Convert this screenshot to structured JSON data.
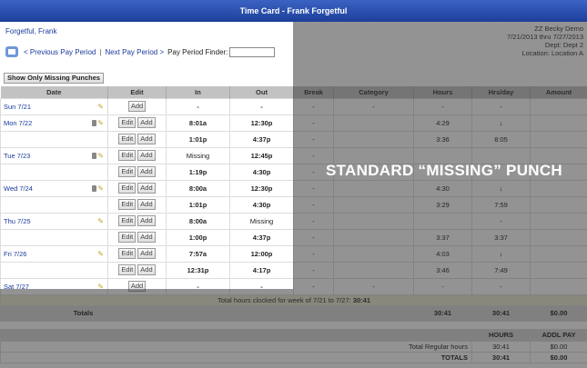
{
  "window_title": "Time Card - Frank Forgetful",
  "employee_name": "Forgetful, Frank",
  "nav": {
    "prev": "< Previous Pay Period",
    "sep": "|",
    "next": "Next Pay Period >",
    "finder_label": "Pay Period Finder:"
  },
  "company": {
    "name": "ZZ Becky Demo",
    "period": "7/21/2013 thru 7/27/2013",
    "dept": "Dept: Dept 2",
    "location": "Location: Location A"
  },
  "missing_button": "Show Only Missing Punches",
  "columns": [
    "Date",
    "Edit",
    "In",
    "Out",
    "Break",
    "Category",
    "Hours",
    "Hrs/day",
    "Amount"
  ],
  "edit_labels": {
    "edit": "Edit",
    "add": "Add"
  },
  "rows": [
    {
      "date": "Sun 7/21",
      "icons": "pencil",
      "edit": [
        "Add"
      ],
      "in": "-",
      "out": "-",
      "break": "-",
      "category": "-",
      "hours": "-",
      "hrsday": "-",
      "amount": ""
    },
    {
      "date": "Mon 7/22",
      "icons": "trash-pencil",
      "edit": [
        "Edit",
        "Add"
      ],
      "in": "8:01a",
      "out": "12:30p",
      "break": "-",
      "category": "",
      "hours": "4:29",
      "hrsday": "↓",
      "amount": ""
    },
    {
      "date": "",
      "icons": "",
      "edit": [
        "Edit",
        "Add"
      ],
      "in": "1:01p",
      "out": "4:37p",
      "break": "-",
      "category": "",
      "hours": "3:36",
      "hrsday": "8:05",
      "amount": ""
    },
    {
      "date": "Tue 7/23",
      "icons": "trash-pencil",
      "edit": [
        "Edit",
        "Add"
      ],
      "in": "Missing",
      "out": "12:45p",
      "break": "-",
      "category": "",
      "hours": "",
      "hrsday": "",
      "amount": ""
    },
    {
      "date": "",
      "icons": "",
      "edit": [
        "Edit",
        "Add"
      ],
      "in": "1:19p",
      "out": "4:30p",
      "break": "-",
      "category": "",
      "hours": "",
      "hrsday": "",
      "amount": ""
    },
    {
      "date": "Wed 7/24",
      "icons": "trash-pencil",
      "edit": [
        "Edit",
        "Add"
      ],
      "in": "8:00a",
      "out": "12:30p",
      "break": "-",
      "category": "",
      "hours": "4:30",
      "hrsday": "↓",
      "amount": ""
    },
    {
      "date": "",
      "icons": "",
      "edit": [
        "Edit",
        "Add"
      ],
      "in": "1:01p",
      "out": "4:30p",
      "break": "-",
      "category": "",
      "hours": "3:29",
      "hrsday": "7:59",
      "amount": ""
    },
    {
      "date": "Thu 7/25",
      "icons": "pencil",
      "edit": [
        "Edit",
        "Add"
      ],
      "in": "8:00a",
      "out": "Missing",
      "break": "-",
      "category": "",
      "hours": "",
      "hrsday": "-",
      "amount": ""
    },
    {
      "date": "",
      "icons": "",
      "edit": [
        "Edit",
        "Add"
      ],
      "in": "1:00p",
      "out": "4:37p",
      "break": "-",
      "category": "",
      "hours": "3:37",
      "hrsday": "3:37",
      "amount": ""
    },
    {
      "date": "Fri 7/26",
      "icons": "pencil",
      "edit": [
        "Edit",
        "Add"
      ],
      "in": "7:57a",
      "out": "12:00p",
      "break": "-",
      "category": "",
      "hours": "4:03",
      "hrsday": "↓",
      "amount": ""
    },
    {
      "date": "",
      "icons": "",
      "edit": [
        "Edit",
        "Add"
      ],
      "in": "12:31p",
      "out": "4:17p",
      "break": "-",
      "category": "",
      "hours": "3:46",
      "hrsday": "7:49",
      "amount": ""
    },
    {
      "date": "Sat 7/27",
      "icons": "pencil",
      "edit": [
        "Add"
      ],
      "in": "-",
      "out": "-",
      "break": "-",
      "category": "-",
      "hours": "-",
      "hrsday": "-",
      "amount": ""
    }
  ],
  "week_total": {
    "label": "Total hours clocked for week of 7/21 to 7/27:",
    "value": "30:41"
  },
  "totals": {
    "label": "Totals",
    "hours": "30:41",
    "hrsday": "30:41",
    "amount": "$0.00"
  },
  "summary": {
    "headers": [
      "HOURS",
      "ADDL PAY"
    ],
    "rows": [
      {
        "label": "Total Regular hours",
        "hours": "30:41",
        "pay": "$0.00"
      },
      {
        "label": "TOTALS",
        "hours": "30:41",
        "pay": "$0.00"
      }
    ]
  },
  "overlay_caption": "STANDARD “MISSING” PUNCH"
}
